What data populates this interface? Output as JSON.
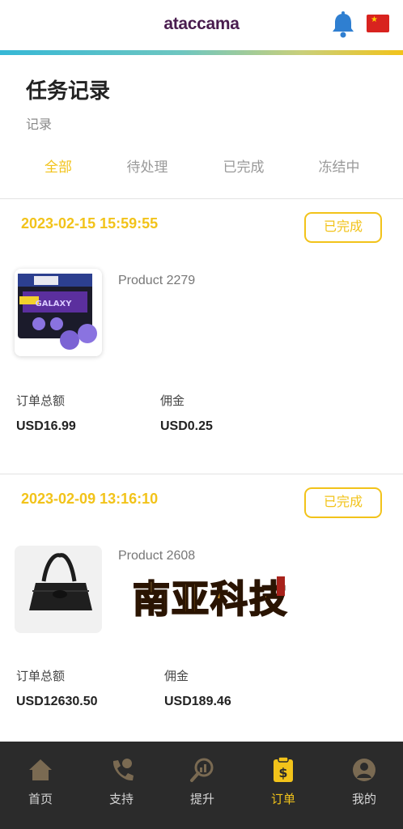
{
  "header": {
    "brand": "ataccama",
    "bell_icon": "bell-icon",
    "flag_icon": "china-flag-icon",
    "accent_color": "#f2c31a"
  },
  "page": {
    "title": "任务记录",
    "subtitle": "记录"
  },
  "tabs": [
    {
      "label": "全部",
      "active": true
    },
    {
      "label": "待处理",
      "active": false
    },
    {
      "label": "已完成",
      "active": false
    },
    {
      "label": "冻结中",
      "active": false
    }
  ],
  "orders": [
    {
      "date": "2023-02-15 15:59:55",
      "status": "已完成",
      "product": "Product 2279",
      "total_label": "订单总额",
      "total": "USD16.99",
      "commission_label": "佣金",
      "commission": "USD0.25",
      "image": "thumbstick-caps-product-image"
    },
    {
      "date": "2023-02-09 13:16:10",
      "status": "已完成",
      "product": "Product 2608",
      "total_label": "订单总额",
      "total": "USD12630.50",
      "commission_label": "佣金",
      "commission": "USD189.46",
      "image": "black-handbag-product-image"
    }
  ],
  "watermark": {
    "text": "南亚科技"
  },
  "bottom_nav": [
    {
      "label": "首页",
      "icon": "home-icon",
      "active": false
    },
    {
      "label": "支持",
      "icon": "phone-support-icon",
      "active": false
    },
    {
      "label": "提升",
      "icon": "upgrade-search-icon",
      "active": false
    },
    {
      "label": "订单",
      "icon": "order-clipboard-icon",
      "active": true
    },
    {
      "label": "我的",
      "icon": "user-icon",
      "active": false
    }
  ]
}
